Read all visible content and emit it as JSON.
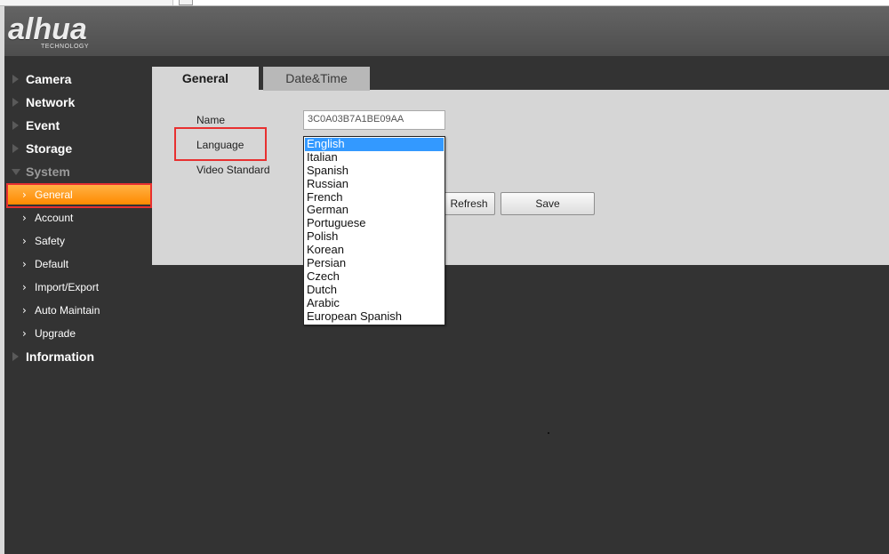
{
  "header": {
    "logo_text": "alhua",
    "logo_subtext": "TECHNOLOGY"
  },
  "sidebar": {
    "items": [
      {
        "label": "Camera"
      },
      {
        "label": "Network"
      },
      {
        "label": "Event"
      },
      {
        "label": "Storage"
      },
      {
        "label": "System"
      },
      {
        "label": "General"
      },
      {
        "label": "Account"
      },
      {
        "label": "Safety"
      },
      {
        "label": "Default"
      },
      {
        "label": "Import/Export"
      },
      {
        "label": "Auto Maintain"
      },
      {
        "label": "Upgrade"
      },
      {
        "label": "Information"
      }
    ],
    "active": "General"
  },
  "tabs": {
    "general": "General",
    "datetime": "Date&Time"
  },
  "form": {
    "name_label": "Name",
    "name_value": "3C0A03B7A1BE09AA",
    "language_label": "Language",
    "video_standard_label": "Video Standard",
    "language_options": [
      "English",
      "Italian",
      "Spanish",
      "Russian",
      "French",
      "German",
      "Portuguese",
      "Polish",
      "Korean",
      "Persian",
      "Czech",
      "Dutch",
      "Arabic",
      "European Spanish"
    ],
    "language_selected": "English"
  },
  "buttons": {
    "refresh": "Refresh",
    "save": "Save"
  },
  "colors": {
    "active_nav": "#ff8a00",
    "highlight_box": "#e83030",
    "selected_option": "#3399ff"
  }
}
